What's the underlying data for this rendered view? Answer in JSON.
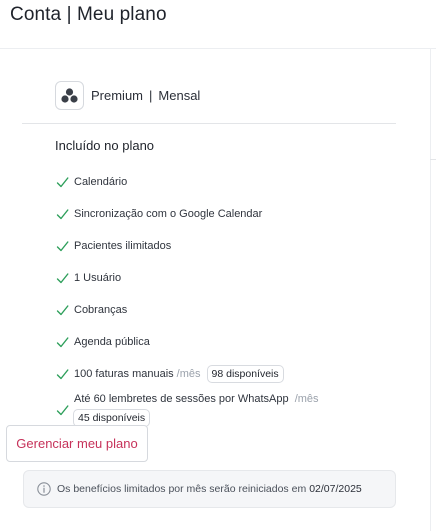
{
  "page": {
    "title": "Conta | Meu plano"
  },
  "plan": {
    "name": "Premium",
    "separator": "|",
    "period": "Mensal",
    "logo_icon": "cluster-icon"
  },
  "included": {
    "title": "Incluído no plano",
    "check_color": "#2e9f5b",
    "items": [
      {
        "label": "Calendário"
      },
      {
        "label": "Sincronização com o Google Calendar"
      },
      {
        "label": "Pacientes ilimitados"
      },
      {
        "label": "1 Usuário"
      },
      {
        "label": "Cobranças"
      },
      {
        "label": "Agenda pública"
      },
      {
        "label": "100 faturas manuais",
        "per": "/mês",
        "available": "98 disponíveis"
      },
      {
        "label": "Até 60 lembretes de sessões por WhatsApp",
        "per": "/mês",
        "available": "45 disponíveis"
      }
    ]
  },
  "actions": {
    "manage_label": "Gerenciar meu plano",
    "accent": "#c6325a"
  },
  "notice": {
    "text": "Os benefícios limitados por mês serão reiniciados em",
    "date": "02/07/2025",
    "icon": "info-icon"
  }
}
